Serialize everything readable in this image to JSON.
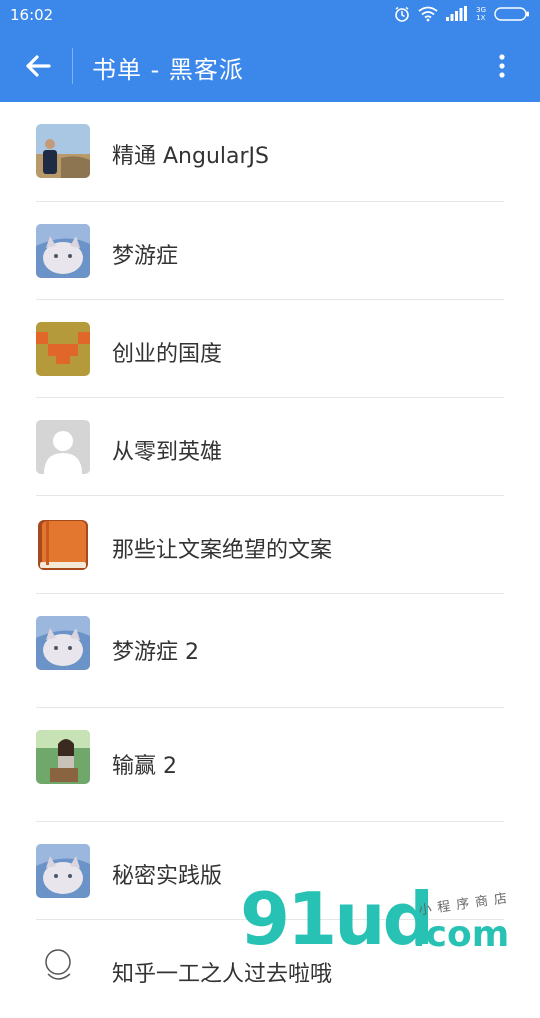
{
  "status_bar": {
    "time": "16:02",
    "net_label_top": "3G",
    "net_label_bottom": "1X"
  },
  "app_bar": {
    "title": "书单 - 黑客派"
  },
  "books": [
    {
      "title": "精通 AngularJS",
      "avatar": "photo-man-field"
    },
    {
      "title": "梦游症",
      "avatar": "photo-cat"
    },
    {
      "title": "创业的国度",
      "avatar": "pixel-orange"
    },
    {
      "title": "从零到英雄",
      "avatar": "default-user"
    },
    {
      "title": "那些让文案绝望的文案",
      "avatar": "book-orange"
    },
    {
      "title": "梦游症 2",
      "avatar": "photo-cat"
    },
    {
      "title": "输赢 2",
      "avatar": "photo-girl"
    },
    {
      "title": "秘密实践版",
      "avatar": "photo-cat"
    },
    {
      "title": "知乎一工之人过去啦哦",
      "avatar": "sketch"
    }
  ],
  "watermark": {
    "brand": "91ud",
    "domain": ".com",
    "tagline": "小程序商店"
  },
  "colors": {
    "primary": "#3b87ea",
    "watermark": "#27c2b4"
  }
}
